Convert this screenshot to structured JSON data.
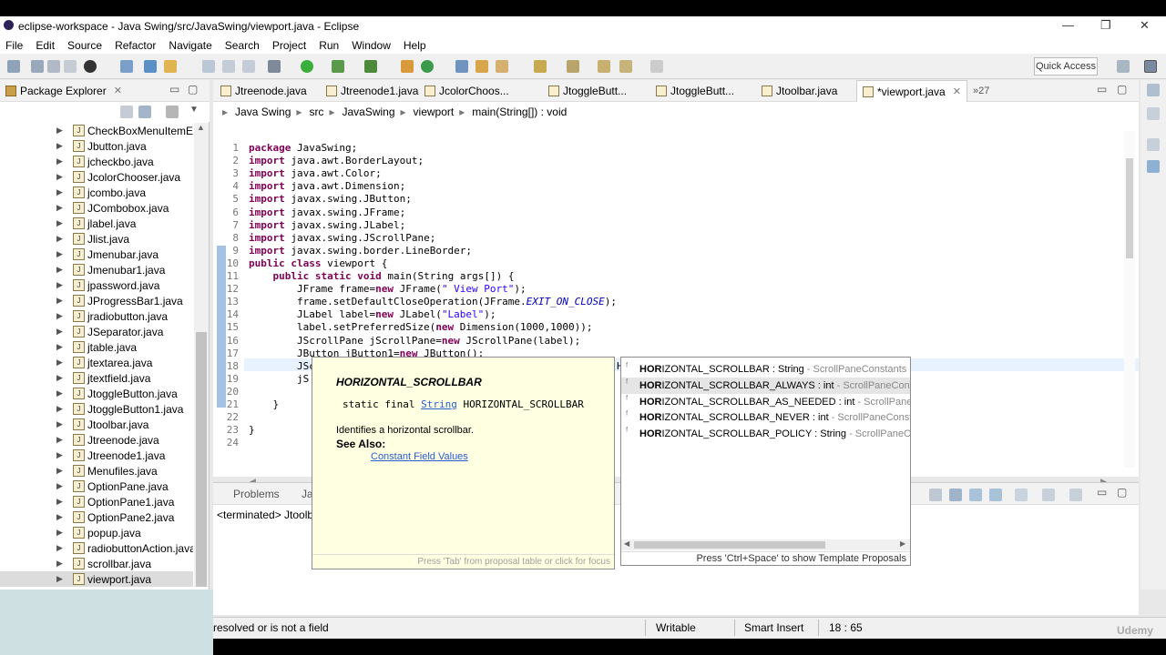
{
  "window": {
    "title": "eclipse-workspace - Java Swing/src/JavaSwing/viewport.java - Eclipse",
    "controls": [
      "—",
      "❐",
      "✕"
    ]
  },
  "menu": [
    "File",
    "Edit",
    "Source",
    "Refactor",
    "Navigate",
    "Search",
    "Project",
    "Run",
    "Window",
    "Help"
  ],
  "toolbar": {
    "quick_access": "Quick Access"
  },
  "package_explorer": {
    "title": "Package Explorer",
    "items": [
      "CheckBoxMenuItemEx",
      "Jbutton.java",
      "jcheckbo.java",
      "JcolorChooser.java",
      "jcombo.java",
      "JCombobox.java",
      "jlabel.java",
      "Jlist.java",
      "Jmenubar.java",
      "Jmenubar1.java",
      "jpassword.java",
      "JProgressBar1.java",
      "jradiobutton.java",
      "JSeparator.java",
      "jtable.java",
      "jtextarea.java",
      "jtextfield.java",
      "JtoggleButton.java",
      "JtoggleButton1.java",
      "Jtoolbar.java",
      "Jtreenode.java",
      "Jtreenode1.java",
      "Menufiles.java",
      "OptionPane.java",
      "OptionPane1.java",
      "OptionPane2.java",
      "popup.java",
      "radiobuttonAction.java",
      "scrollbar.java",
      "viewport.java"
    ],
    "selected_index": 29
  },
  "editor_tabs": [
    "Jtreenode.java",
    "Jtreenode1.java",
    "JcolorChoos...",
    "JtoggleButt...",
    "JtoggleButt...",
    "Jtoolbar.java",
    "*viewport.java",
    "»27"
  ],
  "breadcrumb": [
    "Java Swing",
    "src",
    "JavaSwing",
    "viewport",
    "main(String[]) : void"
  ],
  "code": {
    "line_numbers": [
      "1",
      "2",
      "3",
      "4",
      "5",
      "6",
      "7",
      "8",
      "9",
      "10",
      "11",
      "12",
      "13",
      "14",
      "15",
      "16",
      "17",
      "18",
      "19",
      "20",
      "21",
      "22",
      "23",
      "24"
    ],
    "lines": [
      "package JavaSwing;",
      "import java.awt.BorderLayout;",
      "import java.awt.Color;",
      "import java.awt.Dimension;",
      "import javax.swing.JButton;",
      "import javax.swing.JFrame;",
      "import javax.swing.JLabel;",
      "import javax.swing.JScrollPane;",
      "import javax.swing.border.LineBorder;",
      "public class viewport {",
      "    public static void main(String args[]) {",
      "        JFrame frame=new JFrame(\" View Port\");",
      "        frame.setDefaultCloseOperation(JFrame.EXIT_ON_CLOSE);",
      "        JLabel label=new JLabel(\"Label\");",
      "        label.setPreferredSize(new Dimension(1000,1000));",
      "        JScrollPane jScrollPane=new JScrollPane(label);",
      "        JButton jButton1=new JButton();",
      "        JScrollPane.setHorizontalScrollBarPolicy(JScrollPane.Hor);",
      "        jS",
      "",
      "    }",
      "",
      "}",
      ""
    ]
  },
  "javadoc": {
    "title": "HORIZONTAL_SCROLLBAR",
    "sig_prefix": "static final ",
    "sig_type": "String",
    "sig_name": " HORIZONTAL_SCROLLBAR",
    "description": "Identifies a horizontal scrollbar.",
    "see_also": "See Also:",
    "link": "Constant Field Values",
    "footer": "Press 'Tab' from proposal table or click for focus"
  },
  "proposals": {
    "items": [
      {
        "prefix": "HOR",
        "rest": "IZONTAL_SCROLLBAR : String",
        "owner": " - ScrollPaneConstants"
      },
      {
        "prefix": "HOR",
        "rest": "IZONTAL_SCROLLBAR_ALWAYS : int",
        "owner": " - ScrollPaneConsta"
      },
      {
        "prefix": "HOR",
        "rest": "IZONTAL_SCROLLBAR_AS_NEEDED : int",
        "owner": " - ScrollPaneCor"
      },
      {
        "prefix": "HOR",
        "rest": "IZONTAL_SCROLLBAR_NEVER : int",
        "owner": " - ScrollPaneConstant"
      },
      {
        "prefix": "HOR",
        "rest": "IZONTAL_SCROLLBAR_POLICY : String",
        "owner": " - ScrollPaneCons"
      }
    ],
    "selected_index": 1,
    "footer": "Press 'Ctrl+Space' to show Template Proposals"
  },
  "bottom_panel": {
    "tab1": "Problems",
    "tab2": "Ja",
    "terminated": "<terminated> Jtoolba"
  },
  "status": {
    "message": "resolved or is not a field",
    "writable": "Writable",
    "insert_mode": "Smart Insert",
    "position": "18 : 65"
  },
  "watermark": "Udemy",
  "colors": {
    "keyword": "#7f0055",
    "string": "#2a00ff",
    "constant": "#0000c0",
    "javadoc_bg": "#ffffe1"
  }
}
